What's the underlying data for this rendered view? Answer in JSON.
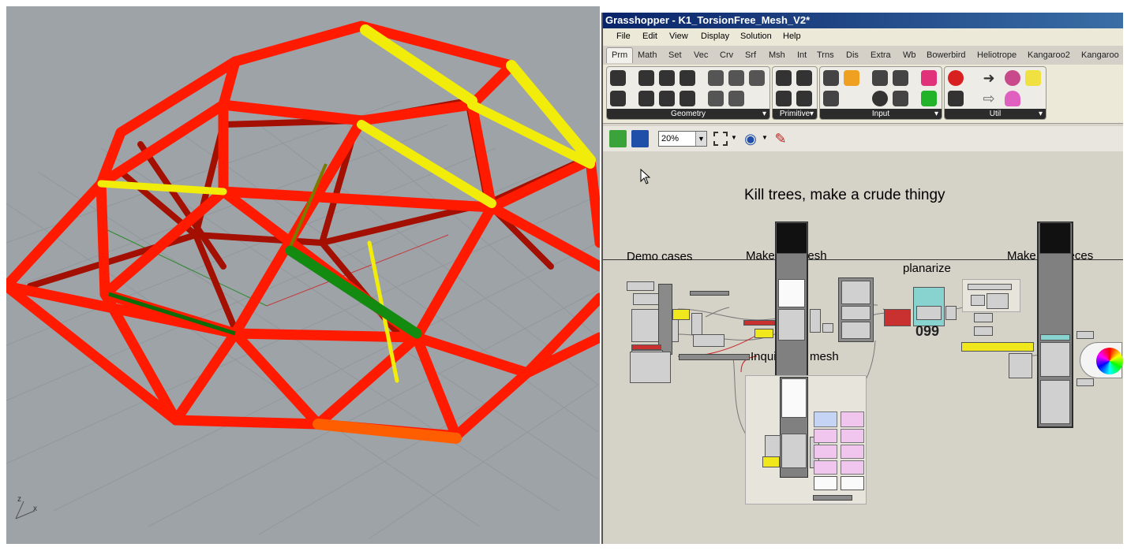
{
  "window": {
    "title": "Grasshopper - K1_TorsionFree_Mesh_V2*"
  },
  "menu": [
    "File",
    "Edit",
    "View",
    "Display",
    "Solution",
    "Help"
  ],
  "tabs": [
    "Prm",
    "Math",
    "Set",
    "Vec",
    "Crv",
    "Srf",
    "Msh",
    "Int",
    "Trns",
    "Dis",
    "Extra",
    "Wb",
    "Bowerbird",
    "Heliotrope",
    "Kangaroo2",
    "Kangaroo"
  ],
  "active_tab": "Prm",
  "ribbon_panels": [
    "Geometry",
    "Primitive",
    "Input",
    "Util"
  ],
  "zoom": "20%",
  "canvas": {
    "header": "Kill trees, make a crude thingy",
    "groups": {
      "demo": "Demo cases",
      "mesh": "Make the mesh",
      "planarize": "planarize",
      "pieces": "Make the pieces",
      "inquire": "Inquire the mesh"
    },
    "counter": "099"
  },
  "viewport": {
    "axis_z": "z",
    "axis_x": "x"
  },
  "colors": {
    "structure_red": "#ff1a00",
    "highlight_yellow": "#f2ec0a",
    "highlight_green": "#138a10",
    "ground": "#9ea3a8"
  }
}
